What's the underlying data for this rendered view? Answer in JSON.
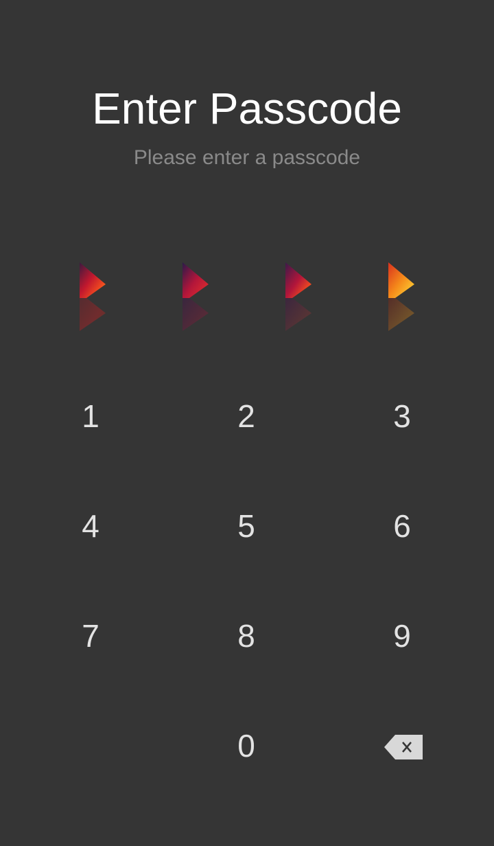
{
  "header": {
    "title": "Enter Passcode",
    "subtitle": "Please enter a passcode"
  },
  "indicators": [
    {
      "name": "passcode-dot-1",
      "icon": "flame-arrow-icon"
    },
    {
      "name": "passcode-dot-2",
      "icon": "flame-arrow-icon"
    },
    {
      "name": "passcode-dot-3",
      "icon": "flame-arrow-icon"
    },
    {
      "name": "passcode-dot-4",
      "icon": "flame-arrow-icon"
    }
  ],
  "keypad": {
    "keys": [
      "1",
      "2",
      "3",
      "4",
      "5",
      "6",
      "7",
      "8",
      "9",
      "0"
    ],
    "backspace_icon": "backspace-icon"
  },
  "colors": {
    "background": "#353535",
    "title": "#ffffff",
    "subtitle": "#8a8a8a",
    "key_text": "#e3e3e3",
    "backspace": "#d8d8d8"
  }
}
